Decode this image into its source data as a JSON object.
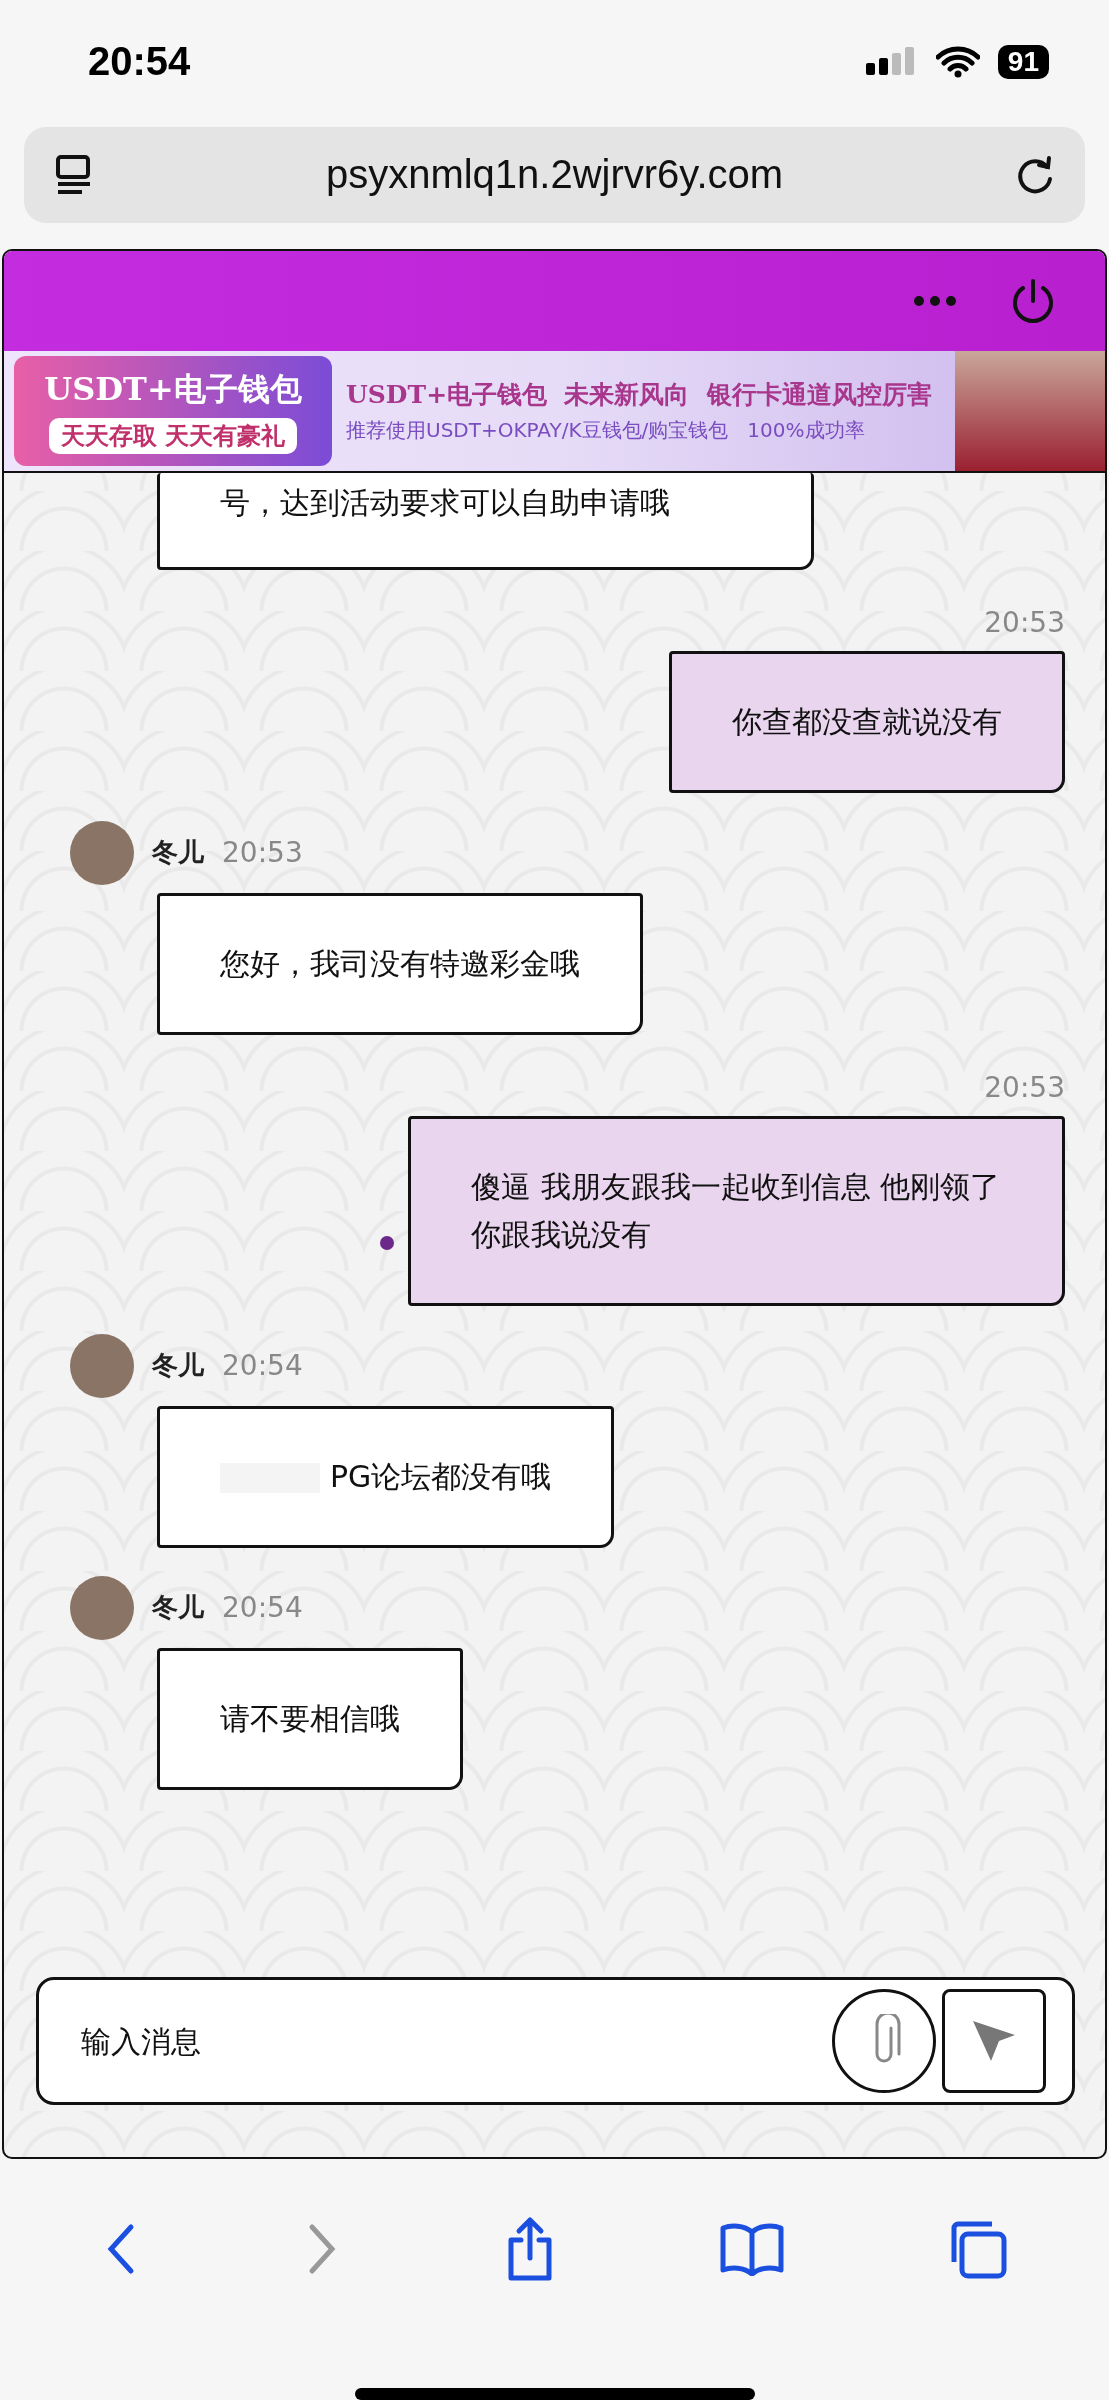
{
  "status_bar": {
    "time": "20:54",
    "battery": "91"
  },
  "address_bar": {
    "url": "psyxnmlq1n.2wjrvr6y.com"
  },
  "banner": {
    "badge_title": "USDT+电子钱包",
    "badge_subtitle": "天天存取 天天有豪礼",
    "headline": "USDT+电子钱包  未来新风向  银行卡通道风控厉害",
    "subline": "推荐使用USDT+OKPAY/K豆钱包/购宝钱包   100%成功率"
  },
  "messages": [
    {
      "kind": "incoming",
      "cut": true,
      "text": "号，达到活动要求可以自助申请哦"
    },
    {
      "kind": "outgoing",
      "time": "20:53",
      "text": "你查都没查就说没有",
      "dot": false
    },
    {
      "kind": "incoming",
      "name": "冬儿",
      "time": "20:53",
      "text": "您好，我司没有特邀彩金哦",
      "redacted": false
    },
    {
      "kind": "outgoing",
      "time": "20:53",
      "text": "傻逼 我朋友跟我一起收到信息 他刚领了你跟我说没有",
      "dot": true
    },
    {
      "kind": "incoming",
      "name": "冬儿",
      "time": "20:54",
      "text": "PG论坛都没有哦",
      "redacted": true
    },
    {
      "kind": "incoming",
      "name": "冬儿",
      "time": "20:54",
      "text": "请不要相信哦",
      "redacted": false
    }
  ],
  "composer": {
    "placeholder": "输入消息"
  }
}
